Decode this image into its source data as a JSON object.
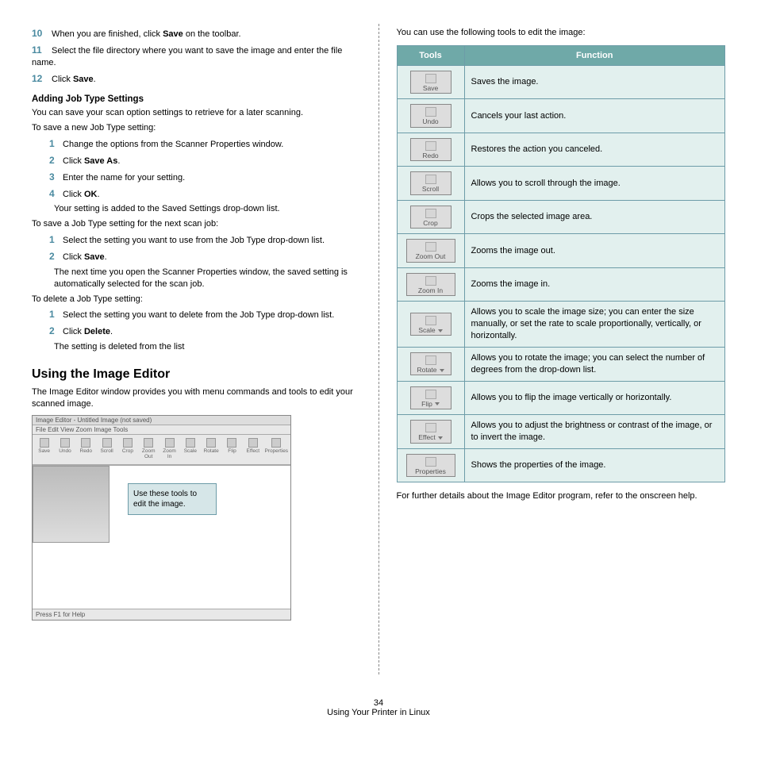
{
  "left": {
    "steps_top": [
      {
        "num": "10",
        "html": "When you are finished, click <strong>Save</strong> on the toolbar."
      },
      {
        "num": "11",
        "html": "Select the file directory where you want to save the image and enter the file name."
      },
      {
        "num": "12",
        "html": "Click <strong>Save</strong>."
      }
    ],
    "sub_heading": "Adding Job Type Settings",
    "p1": "You can save your scan option settings to retrieve for a later scanning.",
    "p2": "To save a new Job Type setting:",
    "steps_save_new": [
      {
        "num": "1",
        "html": "Change the options from the Scanner Properties window."
      },
      {
        "num": "2",
        "html": "Click <strong>Save As</strong>."
      },
      {
        "num": "3",
        "html": "Enter the name for your setting."
      },
      {
        "num": "4",
        "html": "Click <strong>OK</strong>."
      }
    ],
    "note1": "Your setting is added to the Saved Settings drop-down list.",
    "p3": "To save a Job Type setting for the next scan job:",
    "steps_save_next": [
      {
        "num": "1",
        "html": "Select the setting you want to use from the Job Type drop-down list."
      },
      {
        "num": "2",
        "html": "Click <strong>Save</strong>."
      }
    ],
    "note2": "The next time you open the Scanner Properties window, the saved setting is automatically selected for the scan job.",
    "p4": "To delete a Job Type setting:",
    "steps_delete": [
      {
        "num": "1",
        "html": "Select the setting you want to delete from the Job Type drop-down list."
      },
      {
        "num": "2",
        "html": "Click <strong>Delete</strong>."
      }
    ],
    "note3": "The setting is deleted from the list",
    "section_heading": "Using the Image Editor",
    "section_p": "The Image Editor window provides you with menu commands and tools to edit your scanned image.",
    "ie": {
      "title": "Image Editor - Untitled Image (not saved)",
      "menu": "File  Edit  View  Zoom  Image  Tools",
      "toolbar": [
        "Save",
        "Undo",
        "Redo",
        "Scroll",
        "Crop",
        "Zoom Out",
        "Zoom In",
        "Scale",
        "Rotate",
        "Flip",
        "Effect",
        "Properties"
      ],
      "callout": "Use these tools to edit the image.",
      "status": "Press F1 for Help"
    }
  },
  "right": {
    "intro": "You can use the following tools to edit the image:",
    "th_tools": "Tools",
    "th_func": "Function",
    "rows": [
      {
        "label": "Save",
        "wide": false,
        "drop": false,
        "func": "Saves the image."
      },
      {
        "label": "Undo",
        "wide": false,
        "drop": false,
        "func": "Cancels your last action."
      },
      {
        "label": "Redo",
        "wide": false,
        "drop": false,
        "func": "Restores the action you canceled."
      },
      {
        "label": "Scroll",
        "wide": false,
        "drop": false,
        "func": "Allows you to scroll through the image."
      },
      {
        "label": "Crop",
        "wide": false,
        "drop": false,
        "func": "Crops the selected image area."
      },
      {
        "label": "Zoom Out",
        "wide": true,
        "drop": false,
        "func": "Zooms the image out."
      },
      {
        "label": "Zoom In",
        "wide": true,
        "drop": false,
        "func": "Zooms the image in."
      },
      {
        "label": "Scale",
        "wide": false,
        "drop": true,
        "func": "Allows you to scale the image size; you can enter the size manually, or set the rate to scale proportionally, vertically, or horizontally."
      },
      {
        "label": "Rotate",
        "wide": false,
        "drop": true,
        "func": "Allows you to rotate the image; you can select the number of degrees from the drop-down list."
      },
      {
        "label": "Flip",
        "wide": false,
        "drop": true,
        "func": "Allows you to flip the image vertically or horizontally."
      },
      {
        "label": "Effect",
        "wide": false,
        "drop": true,
        "func": "Allows you to adjust the brightness or contrast of the image, or to invert the image."
      },
      {
        "label": "Properties",
        "wide": true,
        "drop": false,
        "func": "Shows the properties of the image."
      }
    ],
    "outro": "For further details about the Image Editor program, refer to the onscreen help."
  },
  "footer": {
    "page": "34",
    "chapter": "Using Your Printer in Linux"
  }
}
